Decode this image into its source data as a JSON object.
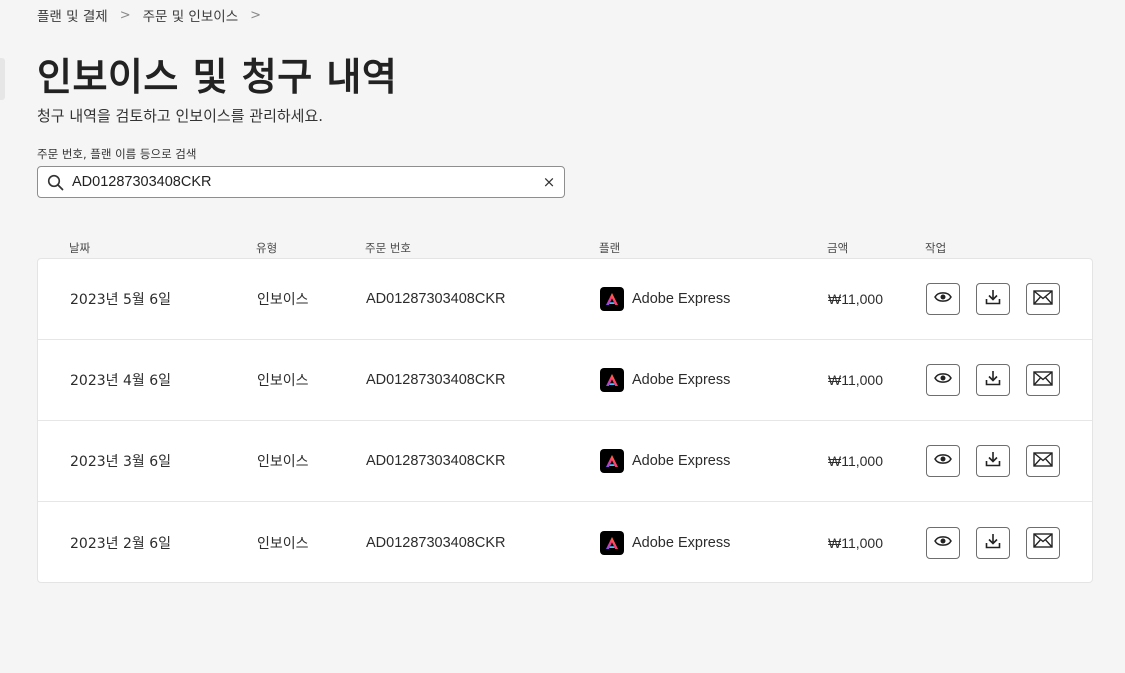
{
  "breadcrumb": [
    "플랜 및 결제",
    "주문 및 인보이스"
  ],
  "page": {
    "title": "인보이스 및 청구 내역",
    "subtitle": "청구 내역을 검토하고 인보이스를 관리하세요."
  },
  "search": {
    "label": "주문 번호, 플랜 이름 등으로 검색",
    "value": "AD01287303408CKR",
    "clear_symbol": "×"
  },
  "table": {
    "headers": [
      "날짜",
      "유형",
      "주문 번호",
      "플랜",
      "금액",
      "작업"
    ],
    "rows": [
      {
        "date": "2023년 5월 6일",
        "type": "인보이스",
        "order": "AD01287303408CKR",
        "plan": "Adobe Express",
        "amount": "₩11,000"
      },
      {
        "date": "2023년 4월 6일",
        "type": "인보이스",
        "order": "AD01287303408CKR",
        "plan": "Adobe Express",
        "amount": "₩11,000"
      },
      {
        "date": "2023년 3월 6일",
        "type": "인보이스",
        "order": "AD01287303408CKR",
        "plan": "Adobe Express",
        "amount": "₩11,000"
      },
      {
        "date": "2023년 2월 6일",
        "type": "인보이스",
        "order": "AD01287303408CKR",
        "plan": "Adobe Express",
        "amount": "₩11,000"
      }
    ],
    "actions": [
      "eye-icon",
      "download-icon",
      "mail-icon"
    ]
  },
  "colors": {
    "background": "#f5f5f5",
    "card": "#ffffff",
    "logo_bg": "#000000"
  }
}
